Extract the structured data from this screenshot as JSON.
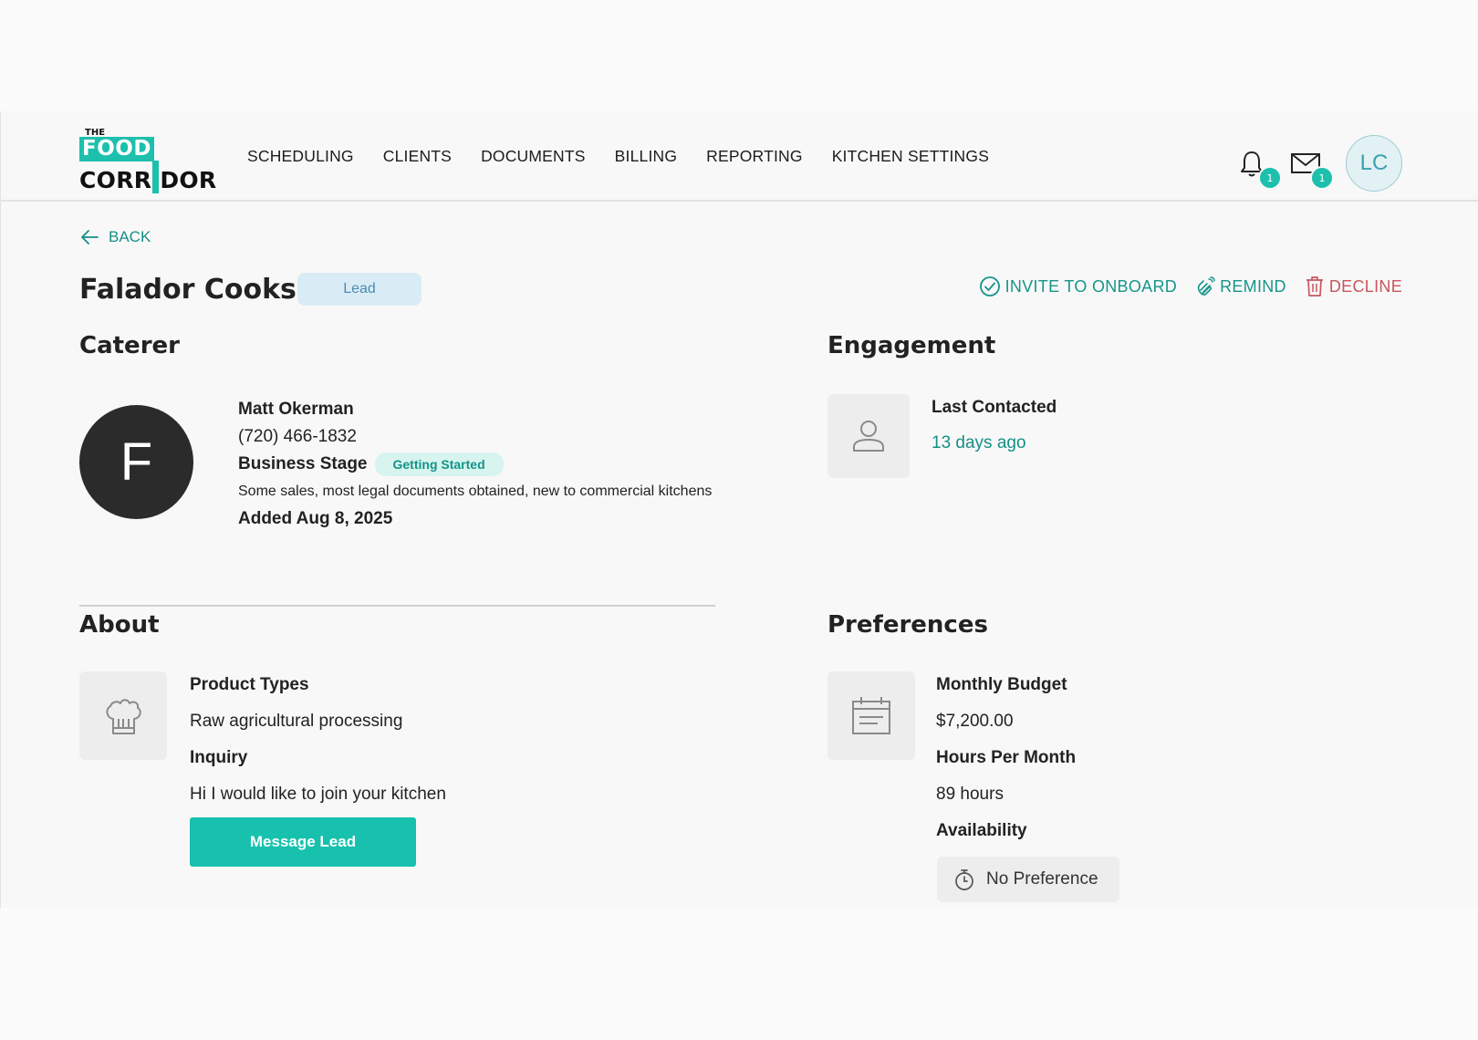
{
  "brand": {
    "logo_the": "THE",
    "logo_food": "FOOD",
    "logo_corr": "CORR",
    "logo_dor": "DOR"
  },
  "nav": {
    "items": [
      "SCHEDULING",
      "CLIENTS",
      "DOCUMENTS",
      "BILLING",
      "REPORTING",
      "KITCHEN SETTINGS"
    ]
  },
  "header": {
    "notifications_count": "1",
    "messages_count": "1",
    "avatar_initials": "LC"
  },
  "back_label": "BACK",
  "lead": {
    "name": "Falador Cooks",
    "status": "Lead"
  },
  "actions": {
    "invite": "INVITE TO ONBOARD",
    "remind": "REMIND",
    "decline": "DECLINE"
  },
  "caterer": {
    "heading": "Caterer",
    "avatar_letter": "F",
    "contact_name": "Matt Okerman",
    "phone": "(720) 466-1832",
    "stage_label": "Business Stage",
    "stage_value": "Getting Started",
    "stage_description": "Some sales, most legal documents obtained, new to commercial kitchens",
    "added": "Added Aug 8, 2025"
  },
  "engagement": {
    "heading": "Engagement",
    "last_contacted_label": "Last Contacted",
    "last_contacted_value": "13 days ago"
  },
  "about": {
    "heading": "About",
    "product_types_label": "Product Types",
    "product_types_value": "Raw agricultural processing",
    "inquiry_label": "Inquiry",
    "inquiry_value": "Hi I would like to join your kitchen",
    "message_button": "Message Lead"
  },
  "preferences": {
    "heading": "Preferences",
    "budget_label": "Monthly Budget",
    "budget_value": "$7,200.00",
    "hours_label": "Hours Per Month",
    "hours_value": "89 hours",
    "availability_label": "Availability",
    "availability_value": "No Preference"
  },
  "colors": {
    "accent": "#1cc0ad",
    "link_teal": "#158f87",
    "decline_red": "#c8565e",
    "lead_pill_bg": "#d9ecf6"
  },
  "icons": {
    "back": "arrow-left-icon",
    "bell": "bell-icon",
    "mail": "envelope-icon",
    "invite": "check-circle-icon",
    "remind": "wave-hand-icon",
    "decline": "trash-icon",
    "engagement": "person-icon",
    "about": "chef-hat-icon",
    "preferences": "calendar-icon",
    "availability": "stopwatch-icon"
  }
}
